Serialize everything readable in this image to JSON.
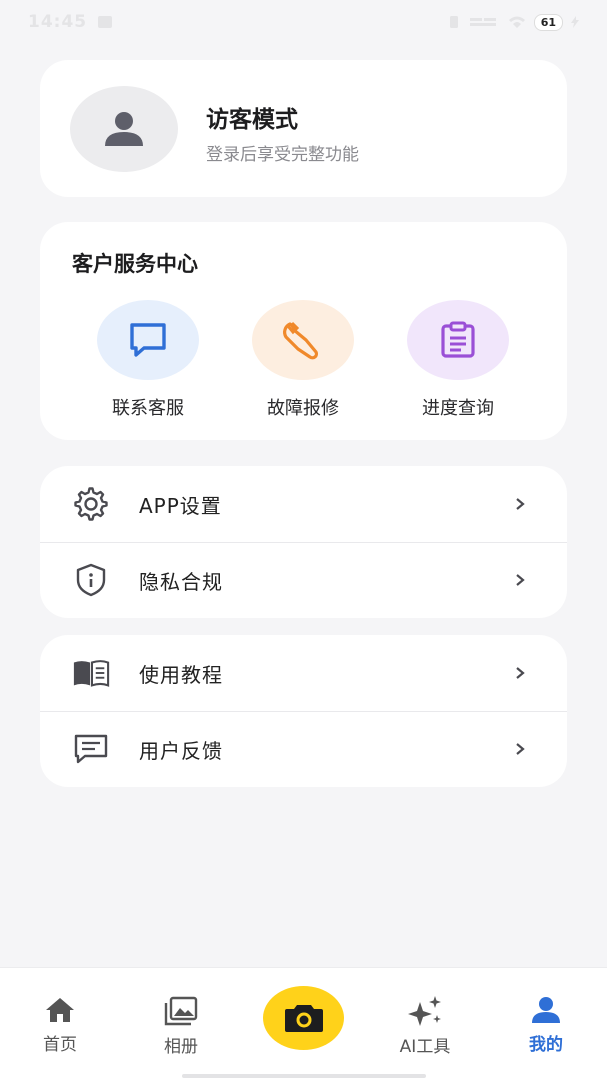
{
  "status_bar": {
    "time": "14:45",
    "battery": "61"
  },
  "profile": {
    "name": "访客模式",
    "subtitle": "登录后享受完整功能",
    "icon": "user-icon"
  },
  "service_center": {
    "title": "客户服务中心",
    "items": [
      {
        "label": "联系客服",
        "icon": "chat-bubble-icon",
        "color": "#2f6fd6",
        "bg": "#e6effc"
      },
      {
        "label": "故障报修",
        "icon": "wrench-icon",
        "color": "#f0892b",
        "bg": "#fdeee0"
      },
      {
        "label": "进度查询",
        "icon": "clipboard-icon",
        "color": "#9a4fd6",
        "bg": "#f1e6fb"
      }
    ]
  },
  "menu_group_1": [
    {
      "label": "APP设置",
      "icon": "gear-icon"
    },
    {
      "label": "隐私合规",
      "icon": "shield-info-icon"
    }
  ],
  "menu_group_2": [
    {
      "label": "使用教程",
      "icon": "book-icon"
    },
    {
      "label": "用户反馈",
      "icon": "feedback-icon"
    }
  ],
  "tab_bar": {
    "tabs": [
      {
        "label": "首页",
        "icon": "home-icon",
        "active": false
      },
      {
        "label": "相册",
        "icon": "gallery-icon",
        "active": false
      },
      {
        "label": "",
        "icon": "camera-icon",
        "active": false
      },
      {
        "label": "AI工具",
        "icon": "sparkle-icon",
        "active": false
      },
      {
        "label": "我的",
        "icon": "person-icon",
        "active": true
      }
    ]
  },
  "colors": {
    "accent": "#2f6fd6",
    "camera": "#ffd21a",
    "background": "#f5f5f7"
  }
}
